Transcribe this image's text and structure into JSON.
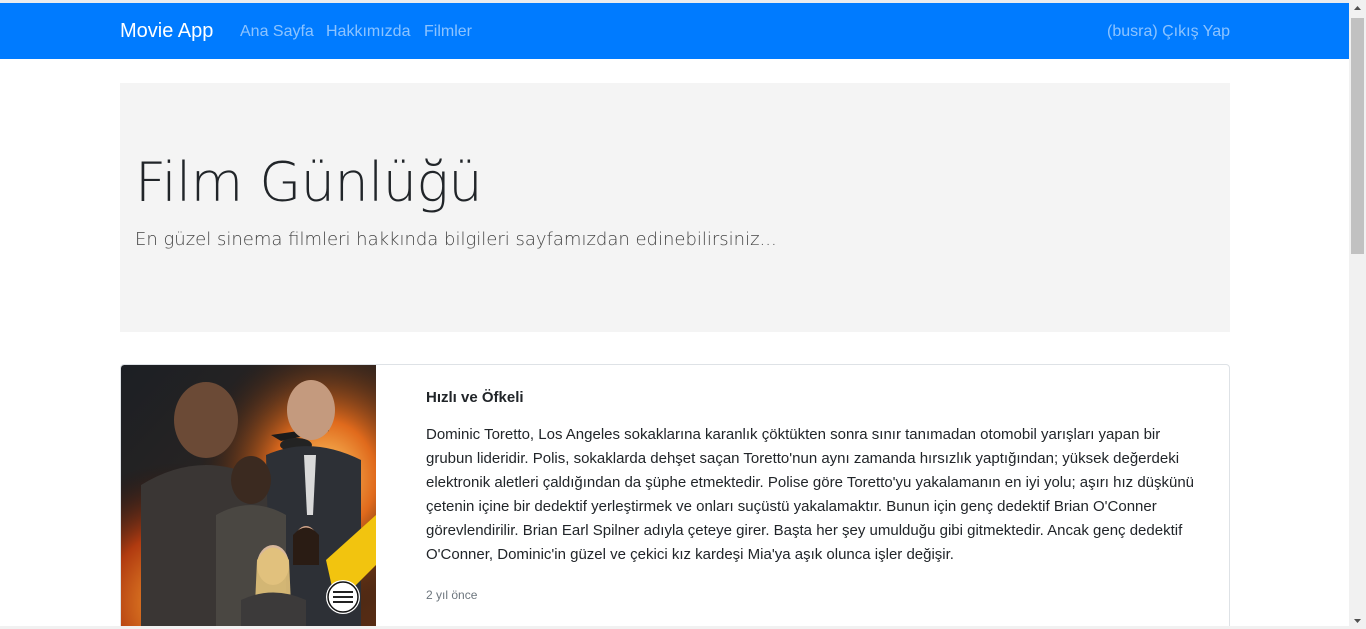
{
  "navbar": {
    "brand": "Movie App",
    "links": [
      "Ana Sayfa",
      "Hakkımızda",
      "Filmler"
    ],
    "logout": "(busra) Çıkış Yap",
    "color": "#007bff"
  },
  "hero": {
    "title": "Film Günlüğü",
    "lead": "En güzel sinema filmleri hakkında bilgileri sayfamızdan edinebilirsiniz..."
  },
  "movies": [
    {
      "title": "Hızlı ve Öfkeli",
      "description": "Dominic Toretto, Los Angeles sokaklarına karanlık çöktükten sonra sınır tanımadan otomobil yarışları yapan bir grubun lideridir. Polis, sokaklarda dehşet saçan Toretto'nun aynı zamanda hırsızlık yaptığından; yüksek değerdeki elektronik aletleri çaldığından da şüphe etmektedir. Polise göre Toretto'yu yakalamanın en iyi yolu; aşırı hız düşkünü çetenin içine bir dedektif yerleştirmek ve onları suçüstü yakalamaktır. Bunun için genç dedektif Brian O'Conner görevlendirilir. Brian Earl Spilner adıyla çeteye girer. Başta her şey umulduğu gibi gitmektedir. Ancak genç dedektif O'Conner, Dominic'in güzel ve çekici kız kardeşi Mia'ya aşık olunca işler değişir.",
      "time": "2 yıl önce",
      "poster_icon": "movie-poster-image"
    }
  ]
}
